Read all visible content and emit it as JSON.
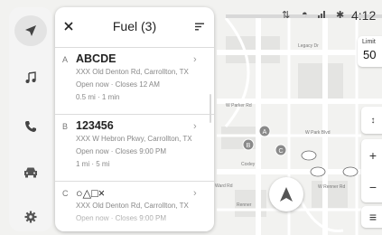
{
  "panel": {
    "title": "Fuel (3)",
    "items": [
      {
        "letter": "A",
        "name": "ABCDE",
        "address": "XXX Old Denton Rd, Carrollton, TX",
        "status": "Open now · Closes 12 AM",
        "distance": "0.5 mi · 1 min"
      },
      {
        "letter": "B",
        "name": "123456",
        "address": "XXX W Hebron Pkwy, Carrollton, TX",
        "status": "Open now · Closes 9:00 PM",
        "distance": "1 mi · 5 mi"
      },
      {
        "letter": "C",
        "name": "○△□×",
        "address": "XXX Old Denton Rd, Carrollton, TX",
        "status": "Open now · Closes 9:00 PM",
        "distance": ""
      }
    ]
  },
  "status_bar": {
    "time": "4:12"
  },
  "speed_limit": {
    "label": "Limit",
    "value": "50"
  },
  "map": {
    "road_labels": [
      "Legacy Dr",
      "W Parker Rd",
      "W Park Blvd",
      "Coxley",
      "W Renner Rd",
      "Renner",
      "Ward Rd"
    ],
    "markers": [
      "A",
      "B",
      "C"
    ]
  },
  "colors": {
    "map_bg": "#f2f2f0",
    "road": "#ffffff",
    "marker": "#8a8a8a",
    "panel_bg": "#ffffff"
  },
  "icons": [
    "navigation-arrow-icon",
    "music-note-icon",
    "phone-icon",
    "car-icon",
    "settings-gear-icon",
    "close-icon",
    "sort-icon",
    "chevron-right-icon",
    "location-arrow-icon",
    "zoom-in-icon",
    "zoom-out-icon",
    "menu-icon",
    "compass-icon",
    "signal-icon",
    "bluetooth-icon"
  ]
}
